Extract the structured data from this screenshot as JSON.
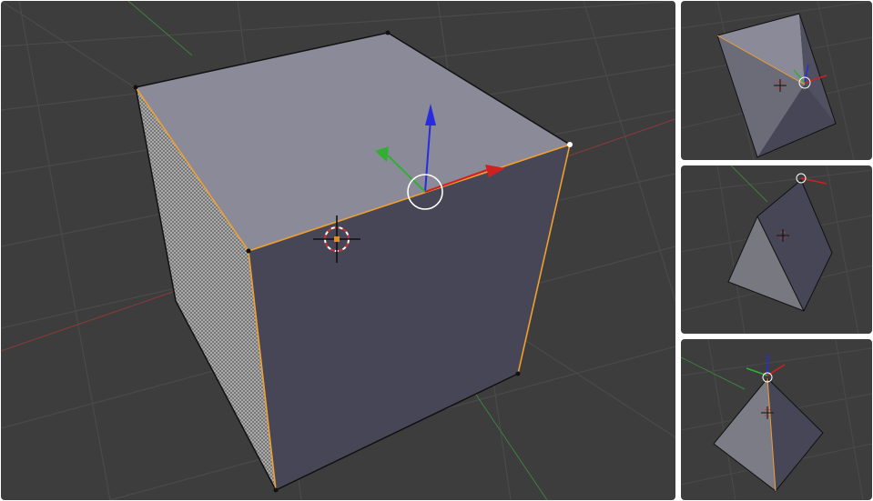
{
  "colors": {
    "viewport_background": "#3d3d3d",
    "grid_line": "#4a4a4a",
    "x_axis": "#8a3a3a",
    "y_axis": "#3f7f3f",
    "top_face": "#8a8a98",
    "front_face": "#464656",
    "selected_edge": "#f0a030",
    "gizmo_x": "#d02020",
    "gizmo_y": "#30b030",
    "gizmo_z": "#2a2ae0",
    "cursor_ring": "#d03030"
  },
  "icons": {
    "transform_gizmo": "move-gizmo-icon",
    "cursor": "3d-cursor-icon"
  }
}
